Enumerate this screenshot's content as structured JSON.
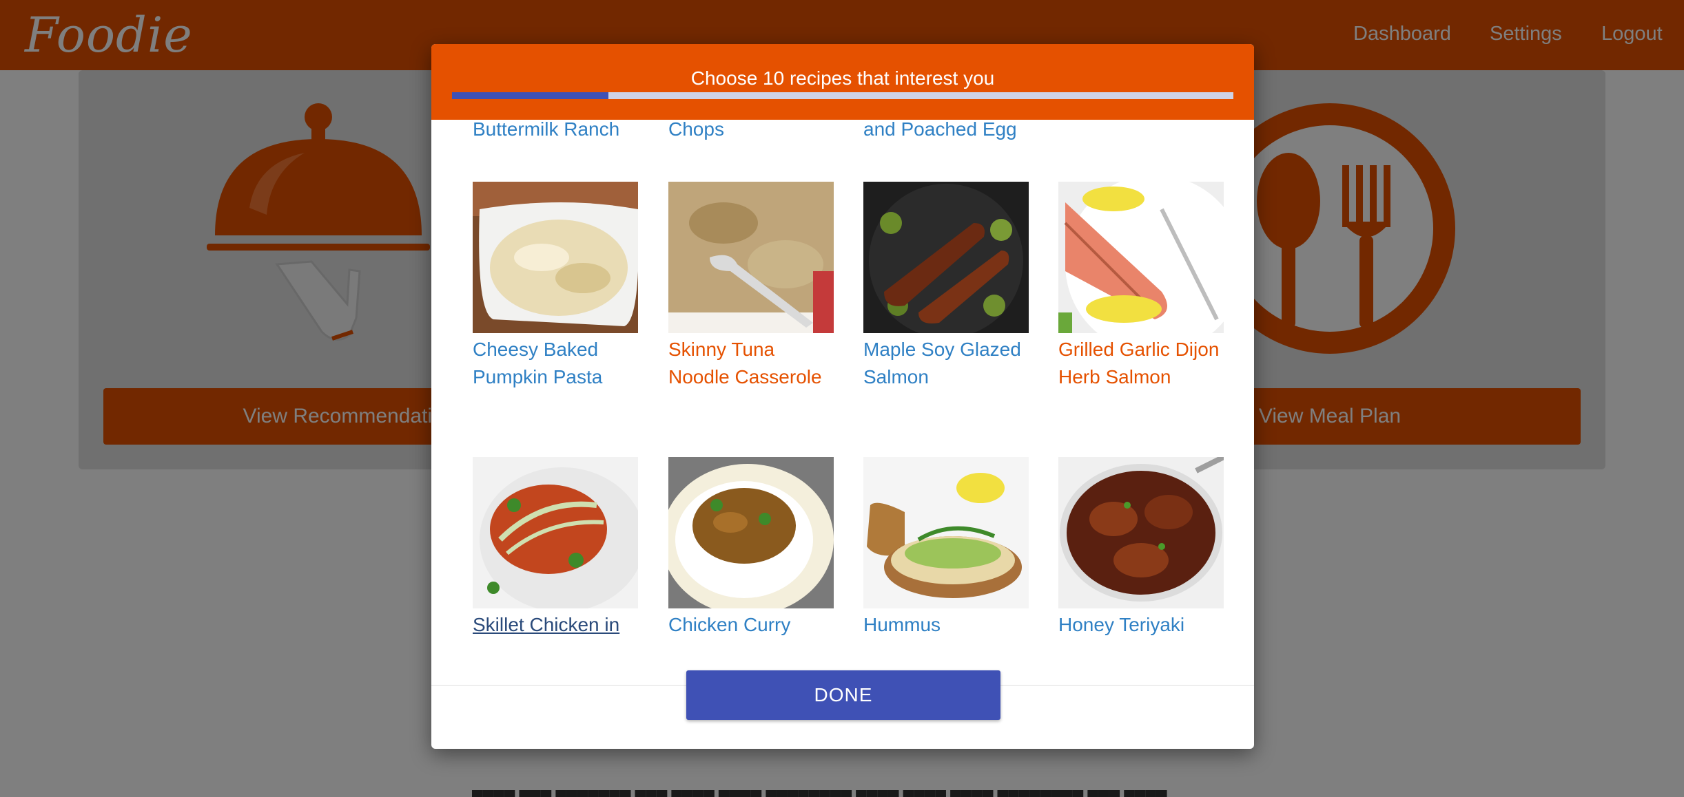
{
  "app": {
    "logo": "Foodie"
  },
  "nav": {
    "dashboard": "Dashboard",
    "settings": "Settings",
    "logout": "Logout"
  },
  "cards": {
    "left_button": "View Recommendations",
    "right_button": "View Meal Plan"
  },
  "modal": {
    "title": "Choose 10 recipes that interest you",
    "progress_fraction": 0.2,
    "partial_titles": [
      "Buttermilk Ranch",
      "Chops",
      "and Poached Egg"
    ],
    "recipes": [
      {
        "title": "Cheesy Baked Pumpkin Pasta",
        "selected": false
      },
      {
        "title": "Skinny Tuna Noodle Casserole",
        "selected": true
      },
      {
        "title": "Maple Soy Glazed Salmon",
        "selected": false
      },
      {
        "title": "Grilled Garlic Dijon Herb Salmon",
        "selected": true
      },
      {
        "title": "Skillet Chicken in",
        "selected": false,
        "hover": true
      },
      {
        "title": "Chicken Curry",
        "selected": false
      },
      {
        "title": "Hummus",
        "selected": false
      },
      {
        "title": "Honey Teriyaki",
        "selected": false
      }
    ],
    "done_label": "DONE"
  },
  "colors": {
    "brand": "#e55100",
    "primary": "#3f51b5",
    "link": "#2f80c4"
  }
}
